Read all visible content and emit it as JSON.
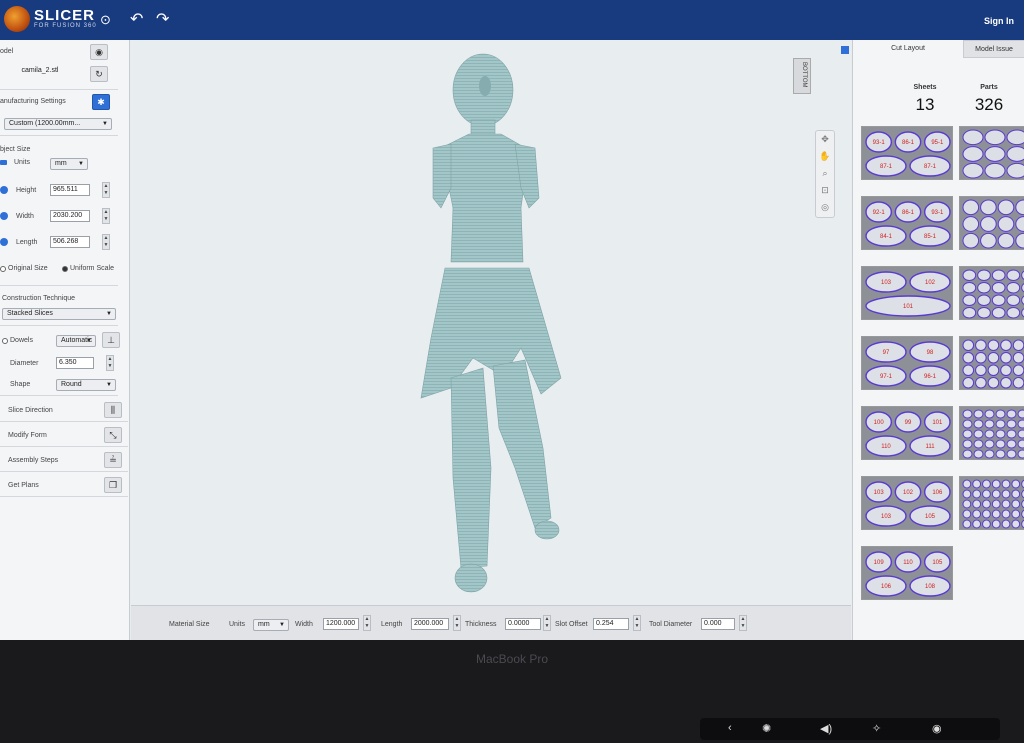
{
  "header": {
    "app_name": "SLICER",
    "app_sub": "FOR FUSION 360",
    "sign_in": "Sign In"
  },
  "left": {
    "model_label": "odel",
    "model_file": "camila_2.stl",
    "manufacturing_label": "anufacturing Settings",
    "manufacturing_value": "Custom (1200.00mm...",
    "object_size_label": "bject Size",
    "units_label": "Units",
    "units_value": "mm",
    "height_label": "Height",
    "height_value": "965.511",
    "width_label": "Width",
    "width_value": "2030.200",
    "length_label": "Length",
    "length_value": "506.268",
    "original_size": "Original Size",
    "uniform_scale": "Uniform Scale",
    "construction_label": "Construction Technique",
    "construction_value": "Stacked Slices",
    "dowels_label": "Dowels",
    "dowels_value": "Automatic",
    "diameter_label": "Diameter",
    "diameter_value": "6.350",
    "shape_label": "Shape",
    "shape_value": "Round",
    "slice_direction": "Slice Direction",
    "modify_form": "Modify Form",
    "assembly_steps": "Assembly Steps",
    "get_plans": "Get Plans"
  },
  "viewport": {
    "viewcube_label": "BOTTOM"
  },
  "bottom": {
    "material_size": "Material Size",
    "units_label": "Units",
    "units_value": "mm",
    "width_label": "Width",
    "width_value": "1200.000",
    "length_label": "Length",
    "length_value": "2000.000",
    "thickness_label": "Thickness",
    "thickness_value": "0.0000",
    "slot_offset_label": "Slot Offset",
    "slot_offset_value": "0.254",
    "tool_diameter_label": "Tool Diameter",
    "tool_diameter_value": "0.000"
  },
  "right": {
    "tab_cut_layout": "Cut Layout",
    "tab_model_issues": "Model Issue",
    "sheets_label": "Sheets",
    "sheets_value": "13",
    "parts_label": "Parts",
    "parts_value": "326",
    "sheet_labels": [
      [
        "93-1",
        "86-1",
        "95-1",
        "87-1",
        "87-1"
      ],
      [
        "92-1",
        "86-1",
        "93-1",
        "84-1",
        "85-1"
      ],
      [
        "103",
        "102",
        "101"
      ],
      [
        "97",
        "98",
        "97-1",
        "96-1"
      ],
      [
        "100",
        "99",
        "101",
        "110",
        "111"
      ],
      [
        "103",
        "102",
        "106",
        "103",
        "105"
      ],
      [
        "109",
        "110",
        "105",
        "106",
        "108"
      ]
    ]
  },
  "device": {
    "label": "MacBook Pro"
  }
}
